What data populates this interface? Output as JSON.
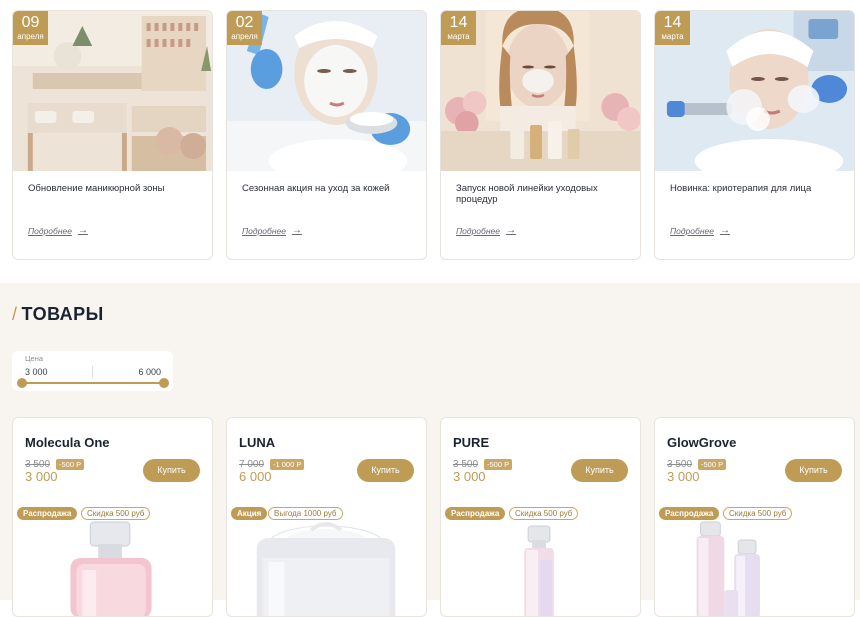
{
  "news": [
    {
      "day": "09",
      "month": "апреля",
      "title": "Обновление маникюрной зоны",
      "more": "Подробнее",
      "image": "manicure-salon-photo"
    },
    {
      "day": "02",
      "month": "апреля",
      "title": "Сезонная акция на уход за кожей",
      "more": "Подробнее",
      "image": "facial-mask-photo"
    },
    {
      "day": "14",
      "month": "марта",
      "title": "Запуск новой линейки уходовых процедур",
      "more": "Подробнее",
      "image": "skincare-line-photo"
    },
    {
      "day": "14",
      "month": "марта",
      "title": "Новинка: криотерапия для лица",
      "more": "Подробнее",
      "image": "cryotherapy-photo"
    }
  ],
  "products_section": {
    "slash": "/",
    "title": "ТОВАРЫ",
    "filter": {
      "label": "Цена",
      "min": "3 000",
      "max": "6 000"
    }
  },
  "products": [
    {
      "name": "Molecula One",
      "old_price": "3 500",
      "discount": "-500 Р",
      "price": "3 000",
      "buy": "Купить",
      "tag": "Распродажа",
      "promo": "Скидка 500 руб",
      "image": "perfume-bottle"
    },
    {
      "name": "LUNA",
      "old_price": "7 000",
      "discount": "-1 000 Р",
      "price": "6 000",
      "buy": "Купить",
      "tag": "Акция",
      "promo": "Выгода 1000 руб",
      "image": "cream-jar"
    },
    {
      "name": "PURE",
      "old_price": "3 500",
      "discount": "-500 Р",
      "price": "3 000",
      "buy": "Купить",
      "tag": "Распродажа",
      "promo": "Скидка 500 руб",
      "image": "serum-bottle"
    },
    {
      "name": "GlowGrove",
      "old_price": "3 500",
      "discount": "-500 Р",
      "price": "3 000",
      "buy": "Купить",
      "tag": "Распродажа",
      "promo": "Скидка 500 руб",
      "image": "cosmetic-set"
    }
  ],
  "colors": {
    "accent": "#bf9c55",
    "text": "#1b2333",
    "section_bg": "#f8f5f0"
  }
}
